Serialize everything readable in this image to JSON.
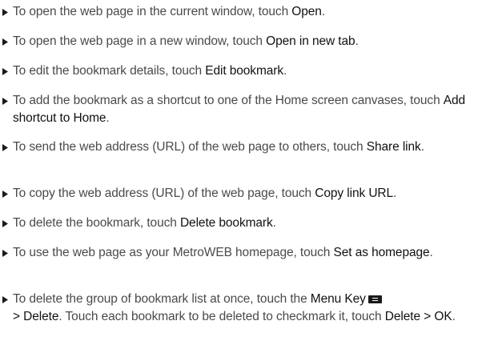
{
  "items": [
    {
      "pre": "To open the web page in the current window, touch ",
      "bold": "Open",
      "post": "."
    },
    {
      "pre": "To open the web page in a new window, touch ",
      "bold": "Open in new tab",
      "post": "."
    },
    {
      "pre": "To edit the bookmark details, touch ",
      "bold": "Edit bookmark",
      "post": "."
    },
    {
      "pre": "To add the bookmark as a shortcut to one of the Home screen canvases, touch ",
      "bold": "Add shortcut to Home",
      "post": "."
    },
    {
      "pre": "To send the web address (URL) of the web page to others, touch ",
      "bold": "Share link",
      "post": "."
    },
    {
      "pre": "To copy the web address (URL) of the web page, touch ",
      "bold": "Copy link URL",
      "post": "."
    },
    {
      "pre": "To delete the bookmark, touch ",
      "bold": "Delete bookmark",
      "post": "."
    },
    {
      "pre": "To use the web page as your MetroWEB homepage, touch ",
      "bold": "Set as homepage",
      "post": "."
    }
  ],
  "last_item": {
    "pre": "To delete the group of bookmark list at once, touch the ",
    "menu_key": "Menu Key",
    "gt1": " > ",
    "delete1": "Delete",
    "mid": ". Touch each bookmark to be deleted to checkmark it, touch ",
    "delete2": "Delete",
    "gt2": " > ",
    "ok": "OK",
    "end": "."
  },
  "icons": {
    "bullet": "triangle-right-icon",
    "menu_key": "menu-key-icon"
  },
  "colors": {
    "body_text": "#4a4a4a",
    "bold_text": "#111111"
  }
}
